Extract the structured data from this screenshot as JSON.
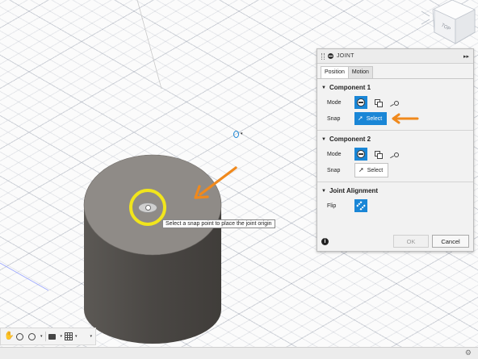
{
  "panel": {
    "title": "JOINT",
    "expand_glyph": "▸▸",
    "tabs": [
      {
        "label": "Position",
        "active": true
      },
      {
        "label": "Motion",
        "active": false
      }
    ],
    "component1": {
      "header": "Component 1",
      "mode_label": "Mode",
      "snap_label": "Snap",
      "snap_button": "Select",
      "snap_state": "active"
    },
    "component2": {
      "header": "Component 2",
      "mode_label": "Mode",
      "snap_label": "Snap",
      "snap_button": "Select",
      "snap_state": "idle"
    },
    "alignment": {
      "header": "Joint Alignment",
      "flip_label": "Flip"
    },
    "ok_label": "OK",
    "cancel_label": "Cancel",
    "info_glyph": "i"
  },
  "viewport": {
    "tooltip": "Select a snap point to place the joint origin",
    "view_cube_label": "TOP"
  },
  "colors": {
    "accent_blue": "#1a86d6",
    "annotation_orange": "#f0891c",
    "highlight_yellow": "#f1e51c",
    "cylinder_top": "#8f8b87",
    "cylinder_side": "#55524e"
  },
  "icons": {
    "nav": [
      "hand-pan-icon",
      "zoom-window-icon",
      "zoom-icon",
      "display-settings-icon",
      "grid-settings-icon",
      "viewports-icon"
    ],
    "panel": [
      "joint-icon",
      "mode-simple-icon",
      "mode-between-icon",
      "mode-center-icon",
      "select-cursor-icon",
      "flip-icon",
      "info-icon"
    ]
  }
}
